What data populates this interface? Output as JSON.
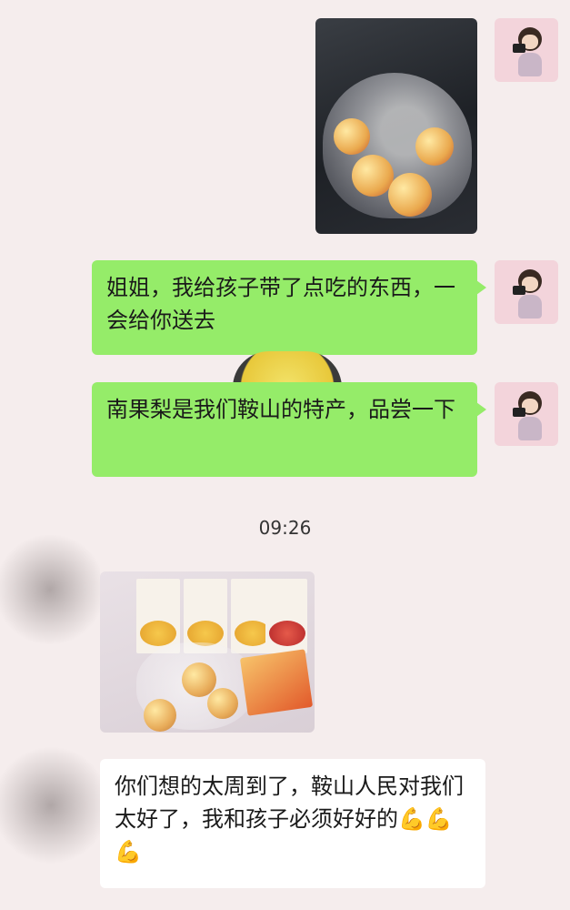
{
  "messages": {
    "m1": {
      "sender": "me",
      "type": "image",
      "description": "plastic bag of pears"
    },
    "m2": {
      "sender": "me",
      "type": "text",
      "text": "姐姐，我给孩子带了点吃的东西，一会给你送去"
    },
    "m3": {
      "sender": "me",
      "type": "text",
      "text": "南果梨是我们鞍山的特产，品尝一下"
    },
    "timestamp": "09:26",
    "m4": {
      "sender": "other",
      "type": "image",
      "description": "snack packs and pears"
    },
    "m5": {
      "sender": "other",
      "type": "text",
      "text": "你们想的太周到了，鞍山人民对我们太好了，我和孩子必须好好的💪💪💪"
    }
  },
  "colors": {
    "background": "#f5eded",
    "sent_bubble": "#95ec69",
    "received_bubble": "#ffffff"
  }
}
